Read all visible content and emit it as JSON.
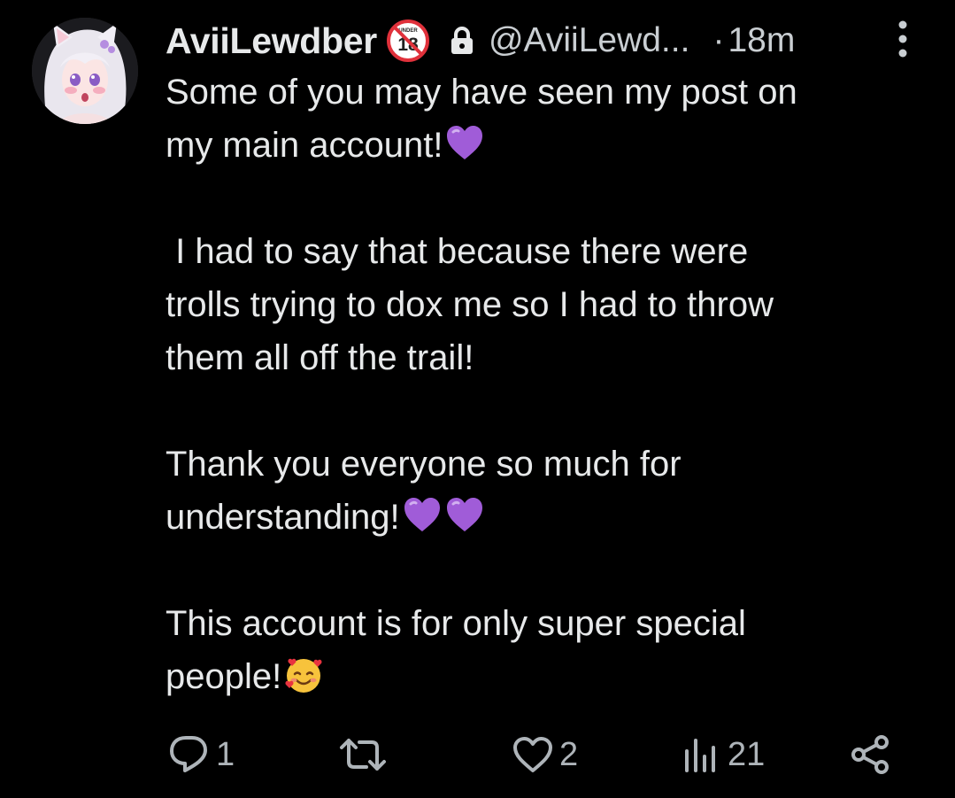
{
  "author": {
    "display_name": "AviiLewdber",
    "handle": "@AviiLewd...",
    "age_badge_text": "UNDER",
    "age_badge_number": "18",
    "time_separator": "·",
    "time": "18m"
  },
  "icons": {
    "age_badge": "no-under-18-icon",
    "protected": "lock-icon",
    "more": "more-vertical-icon",
    "reply": "reply-icon",
    "retweet": "retweet-icon",
    "like": "heart-icon",
    "views": "views-icon",
    "share": "share-icon"
  },
  "post": {
    "line1": "Some of you may have seen my post on",
    "line2": "my main account!",
    "line3": " I had to say that because there were",
    "line4": "trolls trying to dox me so I had to throw",
    "line5": "them all off the trail!",
    "line6": "Thank you everyone so much for",
    "line7": "understanding!",
    "line8": "This account is for only super special",
    "line9": "people!"
  },
  "actions": {
    "replies": "1",
    "likes": "2",
    "views": "21"
  },
  "colors": {
    "background": "#000000",
    "text": "#e7e9ea",
    "muted": "#aeb4b9",
    "heart_purple": "#a05cd8",
    "badge_red": "#e0313b"
  }
}
